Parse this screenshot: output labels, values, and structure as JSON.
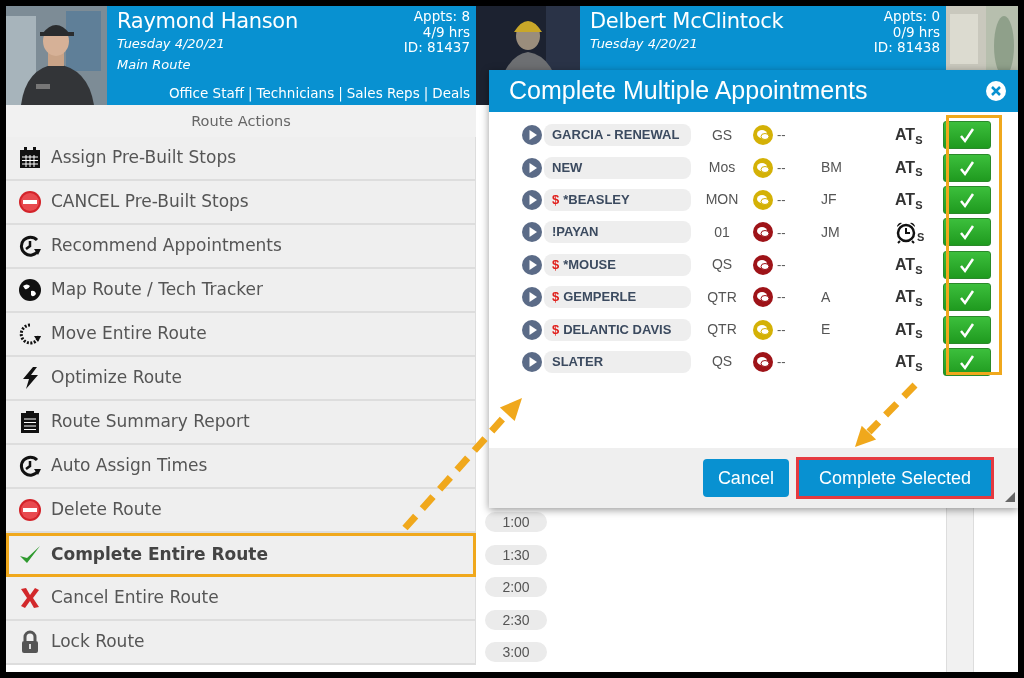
{
  "technicians": [
    {
      "name": "Raymond Hanson",
      "date": "Tuesday 4/20/21",
      "route": "Main Route",
      "appts": "Appts: 8",
      "hours": "4/9 hrs",
      "id": "ID: 81437",
      "links": [
        "Office Staff",
        "Technicians",
        "Sales Reps",
        "Deals"
      ],
      "link_separator": "|"
    },
    {
      "name": "Delbert McClintock",
      "date": "Tuesday 4/20/21",
      "appts": "Appts: 0",
      "hours": "0/9 hrs",
      "id": "ID: 81438"
    }
  ],
  "route_actions": {
    "title": "Route Actions",
    "items": [
      {
        "kind": "calendar",
        "label": "Assign Pre-Built Stops",
        "selected": false
      },
      {
        "kind": "stop",
        "label": "CANCEL Pre-Built Stops",
        "selected": false
      },
      {
        "kind": "clock",
        "label": "Recommend Appointments",
        "selected": false
      },
      {
        "kind": "globe",
        "label": "Map Route / Tech Tracker",
        "selected": false
      },
      {
        "kind": "spinner",
        "label": "Move Entire Route",
        "selected": false
      },
      {
        "kind": "bolt",
        "label": "Optimize Route",
        "selected": false
      },
      {
        "kind": "clipboard",
        "label": "Route Summary Report",
        "selected": false
      },
      {
        "kind": "clock",
        "label": "Auto Assign Times",
        "selected": false
      },
      {
        "kind": "stop",
        "label": "Delete Route",
        "selected": false
      },
      {
        "kind": "check",
        "label": "Complete Entire Route",
        "selected": true
      },
      {
        "kind": "cross",
        "label": "Cancel Entire Route",
        "selected": false
      },
      {
        "kind": "lock",
        "label": "Lock Route",
        "selected": false
      }
    ]
  },
  "time_slots": [
    "1:00",
    "1:30",
    "2:00",
    "2:30",
    "3:00"
  ],
  "modal": {
    "title": "Complete Multiple Appointments",
    "checkbox_column_highlighted": true,
    "rows": [
      {
        "name": "GARCIA - RENEWAL",
        "code": "GS",
        "color": "#d4b106",
        "note": "--",
        "status": {
          "kind": "text",
          "text": "AT$_{S}$"
        },
        "checked": true
      },
      {
        "name": "NEW",
        "code": "Mos",
        "color": "#d4b106",
        "note": "--",
        "initials": "BM",
        "status": {
          "kind": "text",
          "text": "AT$_{S}$"
        },
        "checked": true
      },
      {
        "flag": "$",
        "name": "*BEASLEY",
        "code": "MON",
        "color": "#d4b106",
        "note": "--",
        "initials": "JF",
        "status": {
          "kind": "text",
          "text": "AT$_{S}$"
        },
        "checked": true
      },
      {
        "name": "!PAYAN",
        "code": "01",
        "color": "#9e1318",
        "note": "--",
        "initials": "JM",
        "status": {
          "kind": "alarm",
          "text": "$_{S}$"
        },
        "checked": true
      },
      {
        "flag": "$",
        "name": "*MOUSE",
        "code": "QS",
        "color": "#9e1318",
        "note": "--",
        "status": {
          "kind": "text",
          "text": "AT$_{S}$"
        },
        "checked": true
      },
      {
        "flag": "$",
        "name": "GEMPERLE",
        "code": "QTR",
        "color": "#9e1318",
        "note": "--",
        "initials": "A",
        "status": {
          "kind": "text",
          "text": "AT$_{S}$"
        },
        "checked": true
      },
      {
        "flag": "$",
        "name": "DELANTIC DAVIS",
        "code": "QTR",
        "color": "#d4b106",
        "note": "--",
        "initials": "E",
        "status": {
          "kind": "text",
          "text": "AT$_{S}$"
        },
        "checked": true
      },
      {
        "name": "SLATER",
        "code": "QS",
        "color": "#9e1318",
        "note": "--",
        "status": {
          "kind": "text",
          "text": "AT$_{S}$"
        },
        "checked": true
      }
    ],
    "buttons": [
      {
        "label": "Cancel",
        "highlighted": false
      },
      {
        "label": "Complete Selected",
        "highlighted": true
      }
    ]
  }
}
